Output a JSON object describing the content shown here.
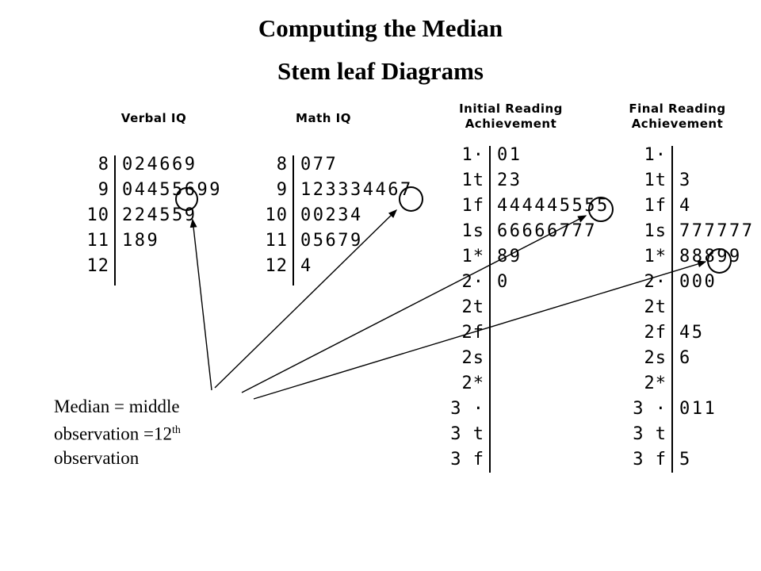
{
  "slide": {
    "title_line1": "Computing the Median",
    "title_line2": "Stem leaf Diagrams",
    "caption_line1": "Median = middle",
    "caption_line2_a": "observation =12",
    "caption_line2_sup": "th",
    "caption_line3": "observation",
    "ink_color": "#000000",
    "background_color": "#ffffff"
  },
  "plots": [
    {
      "id": "verbal-iq",
      "header_lines": [
        "Verbal IQ"
      ],
      "stems": [
        "8",
        "9",
        "10",
        "11",
        "12"
      ],
      "leaves": [
        "024669",
        "04455699",
        "224559",
        "189",
        ""
      ],
      "circled": {
        "row": 1,
        "index": 5,
        "digit": "6"
      }
    },
    {
      "id": "math-iq",
      "header_lines": [
        "Math IQ"
      ],
      "stems": [
        "8",
        "9",
        "10",
        "11",
        "12"
      ],
      "leaves": [
        "077",
        "123334467",
        "00234",
        "05679",
        "4"
      ],
      "circled": {
        "row": 1,
        "index": 8,
        "digit": "7"
      }
    },
    {
      "id": "initial-reading-achievement",
      "header_lines": [
        "Initial Reading",
        "Achievement"
      ],
      "stems": [
        "1·",
        "1t",
        "1f",
        "1s",
        "1*",
        "2·",
        "2t",
        "2f",
        "2s",
        "2*",
        "3 ·",
        "3 t",
        "3 f"
      ],
      "leaves": [
        "01",
        "23",
        "444445555",
        "66666777",
        "89",
        "0",
        "",
        "",
        "",
        "",
        "",
        "",
        ""
      ],
      "circled": {
        "row": 2,
        "index": 7,
        "digit": "5"
      }
    },
    {
      "id": "final-reading-achievement",
      "header_lines": [
        "Final Reading",
        "Achievement"
      ],
      "stems": [
        "1·",
        "1t",
        "1f",
        "1s",
        "1*",
        "2·",
        "2t",
        "2f",
        "2s",
        "2*",
        "3 ·",
        "3 t",
        "3 f"
      ],
      "leaves": [
        "",
        "3",
        "4",
        "777777",
        "88899",
        "000",
        "",
        "45",
        "6",
        "",
        "011",
        "",
        "5"
      ],
      "circled": {
        "row": 4,
        "index": 3,
        "digit": "9"
      }
    }
  ],
  "annotations": {
    "arrow_count": 4,
    "arrow_targets": [
      "verbal-iq-median-leaf",
      "math-iq-median-leaf",
      "initial-reading-median-leaf",
      "final-reading-median-leaf"
    ]
  }
}
